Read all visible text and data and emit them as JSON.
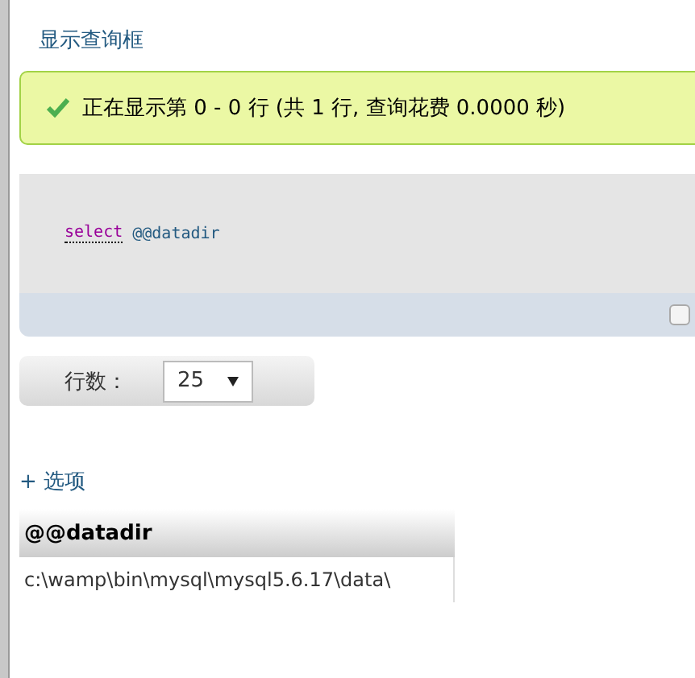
{
  "query_box_link": "显示查询框",
  "message": {
    "kind": "success",
    "text": "正在显示第 0 - 0 行 (共 1 行, 查询花费 0.0000 秒)"
  },
  "sql": {
    "keyword": "select",
    "identifier": "@@datadir"
  },
  "sql_footer": {
    "checkbox_checked": false
  },
  "rows_control": {
    "label": "行数：",
    "value": "25"
  },
  "options_link": "+ 选项",
  "table": {
    "columns": [
      "@@datadir"
    ],
    "rows": [
      [
        "c:\\wamp\\bin\\mysql\\mysql5.6.17\\data\\"
      ]
    ]
  }
}
